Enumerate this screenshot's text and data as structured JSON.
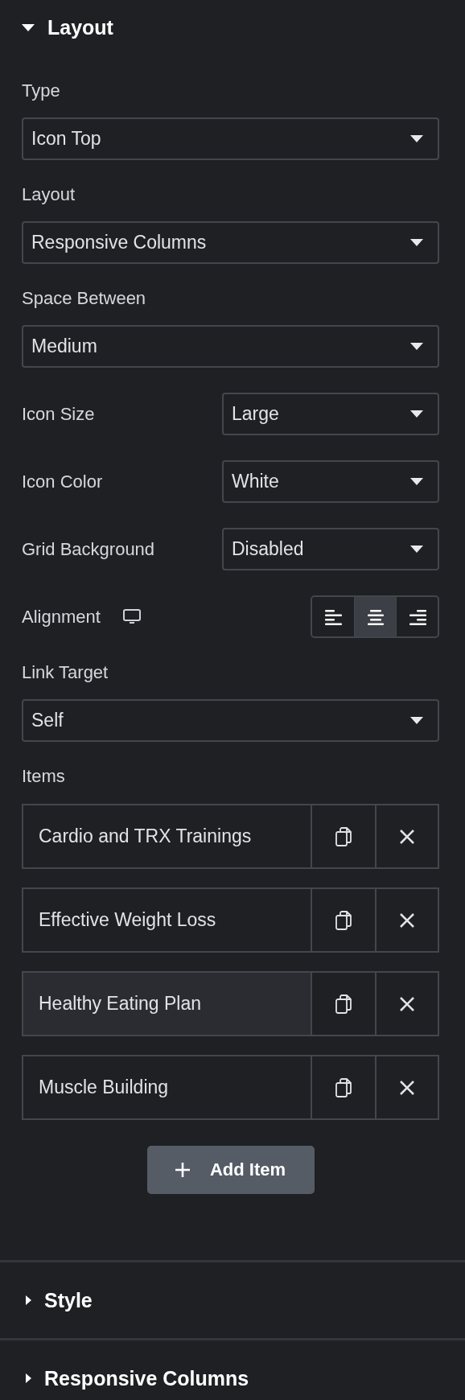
{
  "sections": [
    {
      "title": "Layout",
      "expanded": true,
      "controls": [
        {
          "kind": "select",
          "label": "Type",
          "value": "Icon Top"
        },
        {
          "kind": "select",
          "label": "Layout",
          "value": "Responsive Columns"
        },
        {
          "kind": "select",
          "label": "Space Between",
          "value": "Medium"
        },
        {
          "kind": "inline-select",
          "label": "Icon Size",
          "value": "Large"
        },
        {
          "kind": "inline-select",
          "label": "Icon Color",
          "value": "White"
        },
        {
          "kind": "inline-select",
          "label": "Grid Background",
          "value": "Disabled"
        },
        {
          "kind": "choose",
          "label": "Alignment",
          "options": [
            {
              "kind": "left",
              "selected": false
            },
            {
              "kind": "center",
              "selected": true
            },
            {
              "kind": "right",
              "selected": false
            }
          ]
        },
        {
          "kind": "select",
          "label": "Link Target",
          "value": "Self"
        }
      ],
      "items": {
        "label": "Items",
        "rows": [
          {
            "title": "Cardio and TRX Trainings",
            "selected": false
          },
          {
            "title": "Effective Weight Loss",
            "selected": false
          },
          {
            "title": "Healthy Eating Plan",
            "selected": true
          },
          {
            "title": "Muscle Building",
            "selected": false
          }
        ],
        "add_button": "Add Item"
      }
    },
    {
      "title": "Style",
      "expanded": false
    },
    {
      "title": "Responsive Columns",
      "expanded": false
    }
  ]
}
